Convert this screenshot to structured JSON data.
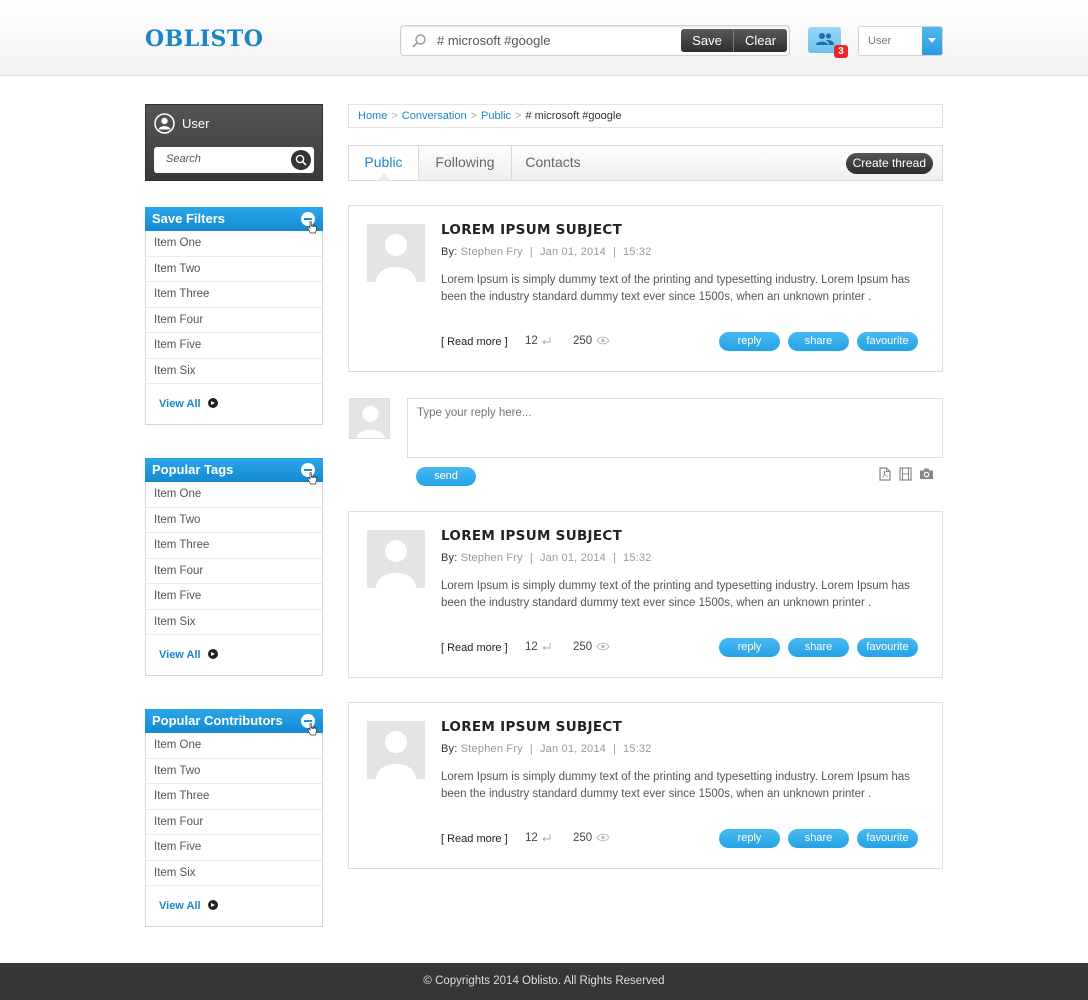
{
  "header": {
    "logo": "OBLISTO",
    "search_value": "# microsoft #google",
    "save_label": "Save",
    "clear_label": "Clear",
    "notification_count": "3",
    "user_select": "User"
  },
  "sidebar": {
    "user_name": "User",
    "search_placeholder": "Search",
    "panels": [
      {
        "title": "Save Filters",
        "items": [
          "Item One",
          "Item Two",
          "Item Three",
          "Item Four",
          "Item Five",
          "Item Six"
        ],
        "view_all": "View All"
      },
      {
        "title": "Popular Tags",
        "items": [
          "Item One",
          "Item Two",
          "Item Three",
          "Item Four",
          "Item Five",
          "Item Six"
        ],
        "view_all": "View All"
      },
      {
        "title": "Popular Contributors",
        "items": [
          "Item One",
          "Item Two",
          "Item Three",
          "Item Four",
          "Item Five",
          "Item Six"
        ],
        "view_all": "View All"
      }
    ]
  },
  "breadcrumb": {
    "items": [
      "Home",
      "Conversation",
      "Public"
    ],
    "current": "# microsoft #google",
    "separator": ">"
  },
  "tabs": {
    "public": "Public",
    "following": "Following",
    "contacts": "Contacts",
    "create_thread": "Create thread"
  },
  "posts": [
    {
      "title": "LOREM IPSUM SUBJECT",
      "by_label": "By:",
      "author": "Stephen Fry",
      "date": "Jan 01, 2014",
      "time": "15:32",
      "body": "Lorem Ipsum is simply dummy text of the printing and typesetting industry. Lorem Ipsum has been the industry standard dummy text ever since 1500s, when an unknown printer .",
      "read_more": "[ Read more ]",
      "replies": "12",
      "views": "250",
      "reply_label": "reply",
      "share_label": "share",
      "favourite_label": "favourite"
    },
    {
      "title": "LOREM IPSUM SUBJECT",
      "by_label": "By:",
      "author": "Stephen Fry",
      "date": "Jan 01, 2014",
      "time": "15:32",
      "body": "Lorem Ipsum is simply dummy text of the printing and typesetting industry. Lorem Ipsum has been the industry standard dummy text ever since 1500s, when an unknown printer .",
      "read_more": "[ Read more ]",
      "replies": "12",
      "views": "250",
      "reply_label": "reply",
      "share_label": "share",
      "favourite_label": "favourite"
    },
    {
      "title": "LOREM IPSUM SUBJECT",
      "by_label": "By:",
      "author": "Stephen Fry",
      "date": "Jan 01, 2014",
      "time": "15:32",
      "body": "Lorem Ipsum is simply dummy text of the printing and typesetting industry. Lorem Ipsum has been the industry standard dummy text ever since 1500s, when an unknown printer .",
      "read_more": "[ Read more ]",
      "replies": "12",
      "views": "250",
      "reply_label": "reply",
      "share_label": "share",
      "favourite_label": "favourite"
    }
  ],
  "reply": {
    "placeholder": "Type your reply here...",
    "send_label": "send"
  },
  "footer": {
    "text": "© Copyrights 2014 Oblisto. All Rights Reserved"
  },
  "colors": {
    "accent": "#1a86c8",
    "pill": "#2aa7ea",
    "dark": "#363636",
    "badge": "#e8262b"
  },
  "icons": [
    "search-icon",
    "users-icon",
    "chevron-down-icon",
    "user-icon",
    "minus-icon",
    "hand-cursor-icon",
    "arrow-right-icon",
    "reply-icon",
    "eye-icon",
    "pdf-icon",
    "film-icon",
    "camera-icon"
  ]
}
